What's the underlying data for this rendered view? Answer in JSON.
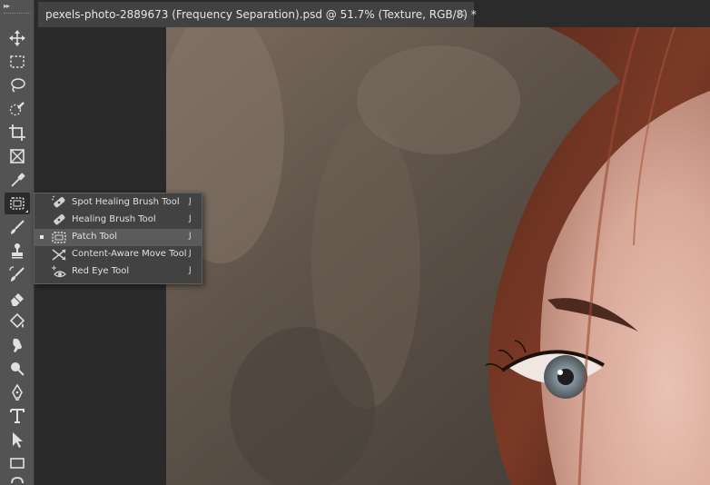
{
  "document": {
    "tab_title": "pexels-photo-2889673 (Frequency Separation).psd @ 51.7% (Texture, RGB/8) *",
    "close_glyph": "×"
  },
  "toolbar": {
    "collapse_glyph": "▸▸",
    "tools": [
      {
        "name": "move-tool",
        "icon": "move-icon"
      },
      {
        "name": "rectangular-marquee-tool",
        "icon": "marquee-icon"
      },
      {
        "name": "lasso-tool",
        "icon": "lasso-icon"
      },
      {
        "name": "quick-selection-tool",
        "icon": "quick-selection-icon"
      },
      {
        "name": "crop-tool",
        "icon": "crop-icon"
      },
      {
        "name": "frame-tool",
        "icon": "frame-icon"
      },
      {
        "name": "eyedropper-tool",
        "icon": "eyedropper-icon"
      },
      {
        "name": "patch-tool",
        "icon": "patch-icon",
        "active": true
      },
      {
        "name": "brush-tool",
        "icon": "brush-icon"
      },
      {
        "name": "clone-stamp-tool",
        "icon": "stamp-icon"
      },
      {
        "name": "history-brush-tool",
        "icon": "history-brush-icon"
      },
      {
        "name": "eraser-tool",
        "icon": "eraser-icon"
      },
      {
        "name": "paint-bucket-tool",
        "icon": "paint-bucket-icon"
      },
      {
        "name": "smudge-tool",
        "icon": "smudge-icon"
      },
      {
        "name": "dodge-tool",
        "icon": "dodge-icon"
      },
      {
        "name": "pen-tool",
        "icon": "pen-icon"
      },
      {
        "name": "type-tool",
        "icon": "type-icon"
      },
      {
        "name": "path-selection-tool",
        "icon": "path-selection-icon"
      },
      {
        "name": "rectangle-tool",
        "icon": "rectangle-icon"
      },
      {
        "name": "hand-tool",
        "icon": "hand-icon"
      }
    ]
  },
  "flyout": {
    "items": [
      {
        "label": "Spot Healing Brush Tool",
        "shortcut": "J",
        "icon": "spot-healing-brush-icon",
        "selected": false
      },
      {
        "label": "Healing Brush Tool",
        "shortcut": "J",
        "icon": "healing-brush-icon",
        "selected": false
      },
      {
        "label": "Patch Tool",
        "shortcut": "J",
        "icon": "patch-icon",
        "selected": true
      },
      {
        "label": "Content-Aware Move Tool",
        "shortcut": "J",
        "icon": "content-aware-move-icon",
        "selected": false
      },
      {
        "label": "Red Eye Tool",
        "shortcut": "J",
        "icon": "red-eye-icon",
        "selected": false
      }
    ]
  },
  "colors": {
    "toolbar_bg": "#535353",
    "panel_bg": "#424242",
    "selected_bg": "#5b5b5b",
    "workspace_bg": "#282828"
  }
}
